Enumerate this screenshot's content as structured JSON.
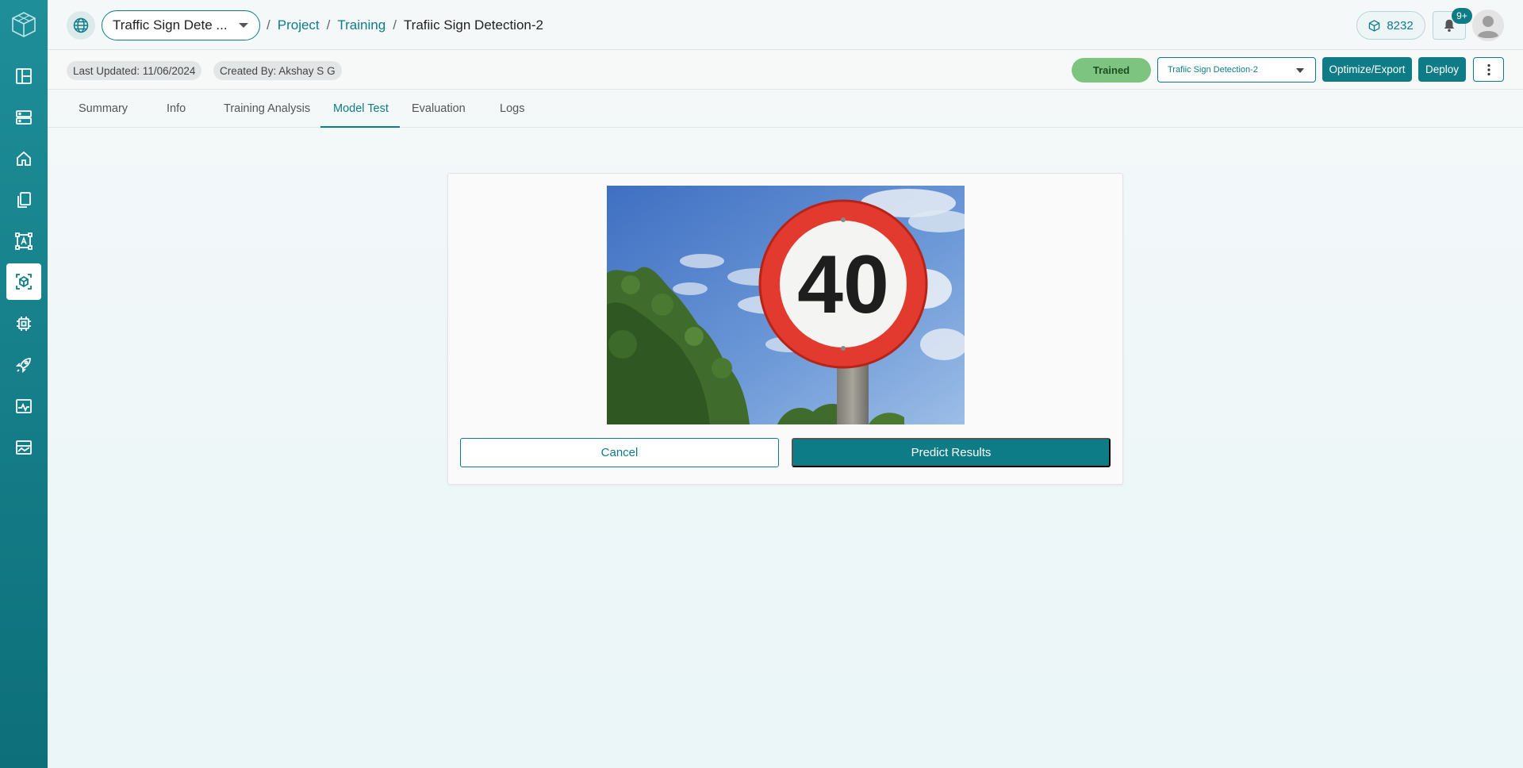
{
  "sidebar": {
    "logo_icon": "cube-logo-icon",
    "items": [
      {
        "name": "dashboard-icon"
      },
      {
        "name": "storage-icon"
      },
      {
        "name": "home-icon"
      },
      {
        "name": "files-icon"
      },
      {
        "name": "annotation-icon"
      },
      {
        "name": "model-training-icon",
        "active": true
      },
      {
        "name": "chip-icon"
      },
      {
        "name": "rocket-icon"
      },
      {
        "name": "monitor-icon"
      },
      {
        "name": "analytics-icon"
      }
    ]
  },
  "header": {
    "project_selector": "Traffic Sign Dete ...",
    "breadcrumb": {
      "project": "Project",
      "training": "Training",
      "current": "Trafiic Sign Detection-2"
    },
    "credits": "8232",
    "notifications_badge": "9+"
  },
  "subheader": {
    "last_updated": "Last Updated: 11/06/2024",
    "created_by": "Created By: Akshay S G",
    "status": "Trained",
    "model_selector": "Trafiic Sign Detection-2",
    "optimize_label": "Optimize/Export",
    "deploy_label": "Deploy"
  },
  "tabs": [
    "Summary",
    "Info",
    "Training Analysis",
    "Model Test",
    "Evaluation",
    "Logs"
  ],
  "active_tab": "Model Test",
  "model_test": {
    "image_sign_text": "40",
    "cancel_label": "Cancel",
    "predict_label": "Predict Results"
  },
  "colors": {
    "accent": "#0e7c86",
    "sidebar": "#0d6f7a",
    "status_trained": "#7cc47f"
  }
}
